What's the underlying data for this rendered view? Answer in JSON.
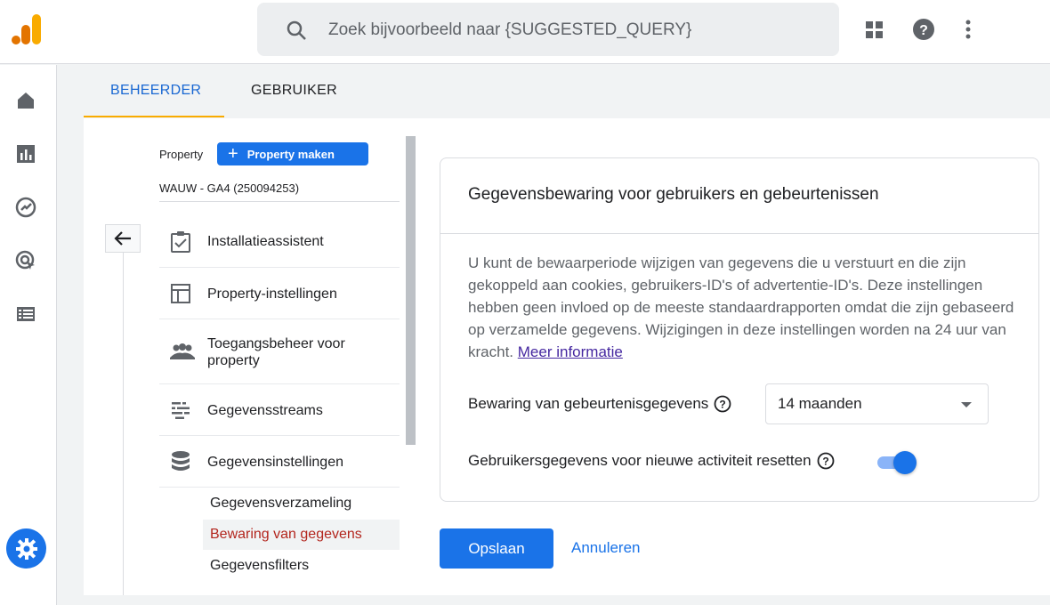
{
  "header": {
    "logo_icon": "analytics-logo-icon",
    "search_placeholder": "Zoek bijvoorbeeld naar {SUGGESTED_QUERY}",
    "icons": [
      "apps-icon",
      "help-icon",
      "more-vert-icon"
    ]
  },
  "rail": {
    "icons": [
      "home-icon",
      "reports-icon",
      "explore-icon",
      "advertising-icon",
      "configure-icon",
      "settings-icon"
    ]
  },
  "tabs": [
    {
      "label": "BEHEERDER",
      "active": true
    },
    {
      "label": "GEBRUIKER",
      "active": false
    }
  ],
  "sidenav": {
    "property_label": "Property",
    "create_button": "Property maken",
    "account": "WAUW - GA4 (250094253)",
    "items": [
      {
        "label": "Installatieassistent",
        "icon": "checklist-icon"
      },
      {
        "label": "Property-instellingen",
        "icon": "layout-icon"
      },
      {
        "label": "Toegangsbeheer voor property",
        "icon": "people-icon"
      },
      {
        "label": "Gegevensstreams",
        "icon": "streams-icon"
      },
      {
        "label": "Gegevensinstellingen",
        "icon": "database-icon"
      }
    ],
    "subitems": [
      {
        "label": "Gegevensverzameling",
        "active": false
      },
      {
        "label": "Bewaring van gegevens",
        "active": true
      },
      {
        "label": "Gegevensfilters",
        "active": false
      }
    ]
  },
  "card": {
    "title": "Gegevensbewaring voor gebruikers en gebeurtenissen",
    "description": "U kunt de bewaarperiode wijzigen van gegevens die u verstuurt en die zijn gekoppeld aan cookies, gebruikers-ID's of advertentie-ID's. Deze instellingen hebben geen invloed op de meeste standaardrapporten omdat die zijn gebaseerd op verzamelde gegevens. Wijzigingen in deze instellingen worden na 24 uur van kracht.",
    "link": "Meer informatie",
    "event_retention_label": "Bewaring van gebeurtenisgegevens",
    "event_retention_value": "14 maanden",
    "reset_label": "Gebruikersgegevens voor nieuwe activiteit resetten",
    "reset_enabled": true
  },
  "actions": {
    "save": "Opslaan",
    "cancel": "Annuleren"
  },
  "colors": {
    "primary": "#1a73e8",
    "tab_indicator": "#f9ab00",
    "active_subitem": "#b3261e"
  }
}
